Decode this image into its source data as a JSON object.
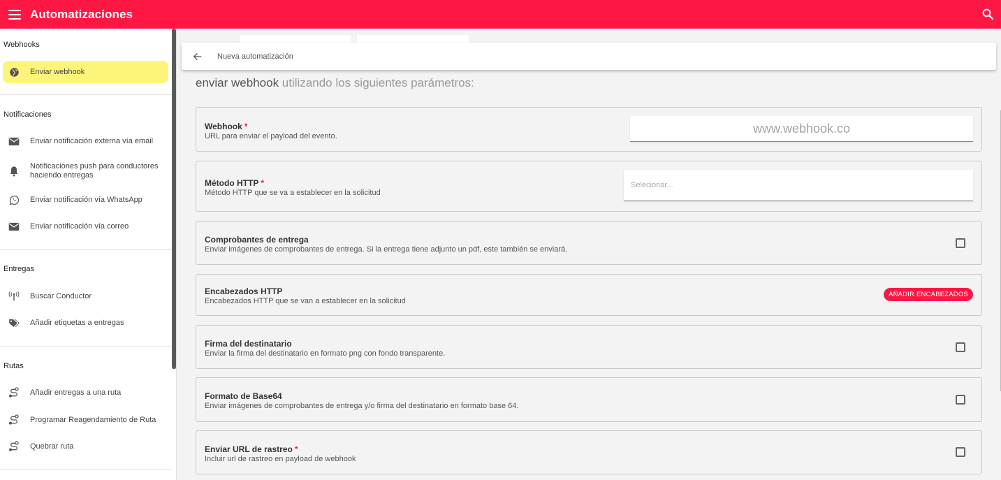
{
  "app": {
    "title": "Automatizaciones"
  },
  "colors": {
    "brand": "#ff1744",
    "active_item": "#fdf57a"
  },
  "sidebar": {
    "sections": [
      {
        "title": "Webhooks",
        "items": [
          {
            "label": "Enviar webhook",
            "icon": "globe-icon",
            "active": true
          }
        ]
      },
      {
        "title": "Notificaciones",
        "items": [
          {
            "label": "Enviar notificación externa vía email",
            "icon": "mail-icon"
          },
          {
            "label": "Notificaciones push para conductores haciendo entregas",
            "icon": "bell-icon"
          },
          {
            "label": "Enviar notificación vía WhatsApp",
            "icon": "whatsapp-icon"
          },
          {
            "label": "Enviar notificación vía correo",
            "icon": "mail-icon"
          }
        ]
      },
      {
        "title": "Entregas",
        "items": [
          {
            "label": "Buscar Conductor",
            "icon": "antenna-icon"
          },
          {
            "label": "Añadir etiquetas a entregas",
            "icon": "tag-icon"
          }
        ]
      },
      {
        "title": "Rutas",
        "items": [
          {
            "label": "Añadir entregas a una ruta",
            "icon": "route-icon"
          },
          {
            "label": "Programar Reagendamiento de Ruta",
            "icon": "route-icon"
          },
          {
            "label": "Quebrar ruta",
            "icon": "route-icon"
          }
        ]
      }
    ]
  },
  "header": {
    "title": "Nueva automatización"
  },
  "subtitle": {
    "strong": "enviar webhook",
    "rest": " utilizando los siguientes parámetros:"
  },
  "fields": {
    "webhook": {
      "title": "Webhook",
      "required": "*",
      "desc": "URL para enviar el payload del evento.",
      "placeholder": "www.webhook.co"
    },
    "http_method": {
      "title": "Método HTTP",
      "required": "*",
      "desc": "Método HTTP que se va a establecer en la solicitud",
      "placeholder": "Selecionar..."
    },
    "proofs": {
      "title": "Comprobantes de entrega",
      "desc": "Enviar imágenes de comprobantes de entrega. Si la entrega tiene adjunto un pdf, este también se enviará."
    },
    "headers": {
      "title": "Encabezados HTTP",
      "desc": "Encabezados HTTP que se van a establecer en la solicitud",
      "button": "AÑADIR ENCABEZADOS"
    },
    "signature": {
      "title": "Firma del destinatario",
      "desc": "Enviar la firma del destinatario en formato png con fondo transparente."
    },
    "base64": {
      "title": "Formato de Base64",
      "desc": "Enviar imágenes de comprobantes de entrega y/o firma del destinatario en formato base 64."
    },
    "tracking": {
      "title": "Enviar URL de rastreo",
      "required": "*",
      "desc": "Incluir url de rastreo en payload de webhook"
    }
  }
}
